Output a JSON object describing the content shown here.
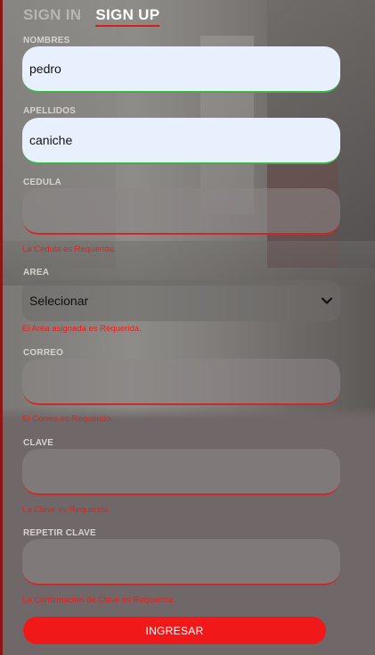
{
  "tabs": {
    "sign_in": "SIGN IN",
    "sign_up": "SIGN UP"
  },
  "fields": {
    "nombres": {
      "label": "NOMBRES",
      "value": "pedro"
    },
    "apellidos": {
      "label": "APELLIDOS",
      "value": "caniche"
    },
    "cedula": {
      "label": "CEDULA",
      "value": "",
      "error": "La Cedula es Requerida."
    },
    "area": {
      "label": "AREA",
      "value": "Selecionar",
      "error": "El Area asignada es Requerida."
    },
    "correo": {
      "label": "CORREO",
      "value": "",
      "error": "El Correo es Requerido."
    },
    "clave": {
      "label": "CLAVE",
      "value": "",
      "error": "La Clave es Requerida."
    },
    "repetir_clave": {
      "label": "REPETIR CLAVE",
      "value": "",
      "error": "La Confirmacion de Clave es Requerida."
    }
  },
  "submit_label": "INGRESAR",
  "colors": {
    "accent_red": "#f01818",
    "error_red": "#e6201d",
    "valid_green": "#3db345",
    "filled_input_bg": "#e8f0fe"
  },
  "icons": {
    "area_select": "chevron-down-icon"
  }
}
